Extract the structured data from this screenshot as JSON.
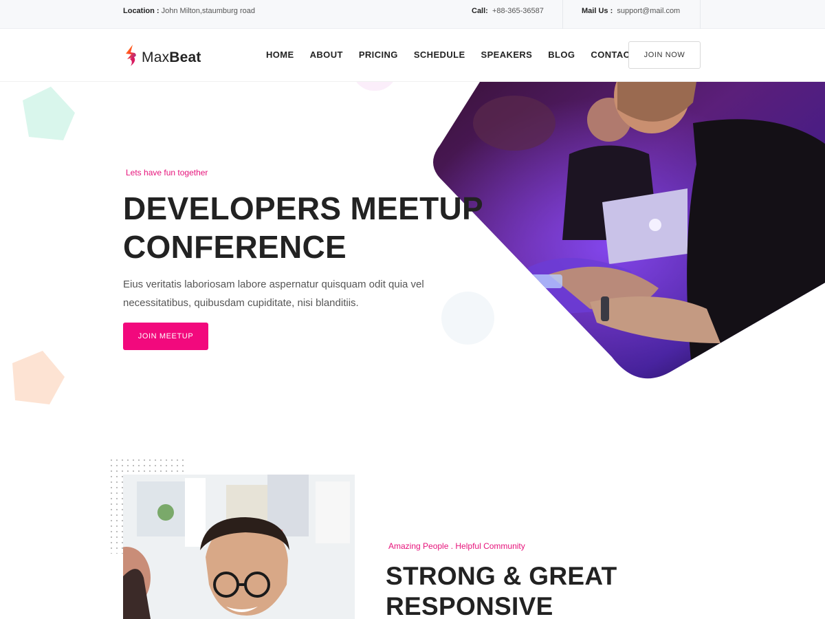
{
  "topbar": {
    "location_label": "Location :",
    "location_value": "John Milton,staumburg road",
    "call_label": "Call:",
    "call_value": "+88-365-36587",
    "mail_label": "Mail Us :",
    "mail_value": "support@mail.com"
  },
  "header": {
    "logo_light": "Max",
    "logo_bold": "Beat",
    "nav": [
      "HOME",
      "ABOUT",
      "PRICING",
      "SCHEDULE",
      "SPEAKERS",
      "BLOG",
      "CONTACT"
    ],
    "join_label": "JOIN NOW"
  },
  "hero": {
    "tagline": "Lets have fun together",
    "title_line1": "DEVELOPERS MEETUP",
    "title_line2": "CONFERENCE",
    "description": "Eius veritatis laboriosam labore aspernatur quisquam odit quia vel necessitatibus, quibusdam cupiditate, nisi blanditiis.",
    "button_label": "JOIN MEETUP"
  },
  "about": {
    "tagline": "Amazing People . Helpful Community",
    "title_line1": "STRONG & GREAT",
    "title_line2": "RESPONSIVE"
  },
  "colors": {
    "accent": "#f2097d",
    "tagline": "#e6127a",
    "mint_shape": "#d9f6ec",
    "peach_shape": "#fde3d3"
  },
  "icons": {
    "logo": "flame-logo-icon",
    "hero_image": "developers-laptop-photo",
    "about_image": "smiling-man-glasses-photo"
  }
}
